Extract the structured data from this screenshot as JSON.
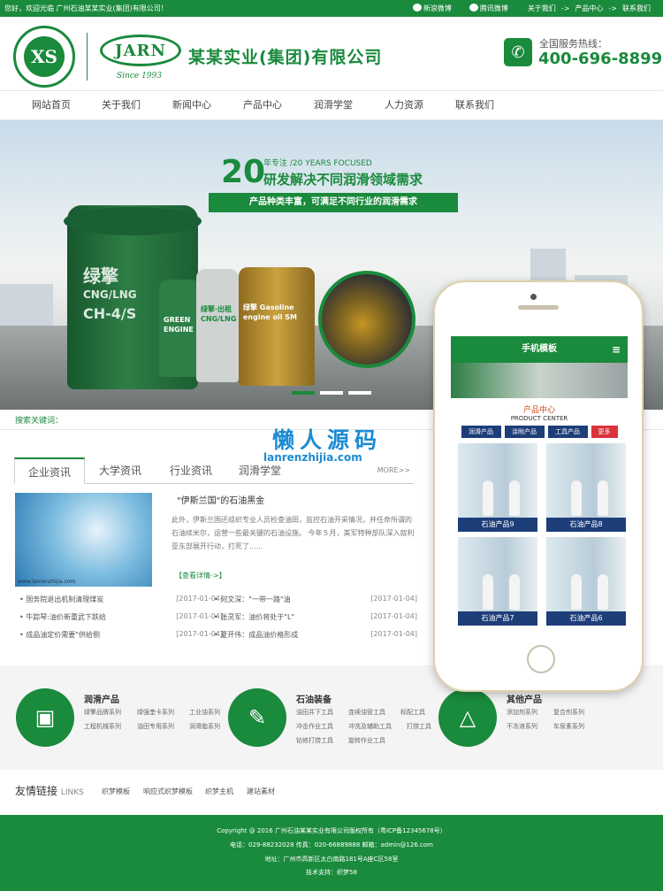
{
  "topbar": {
    "welcome": "您好，欢迎光临 广州石油某某实业(集团)有限公司！",
    "weibo_sina": "新浪微博",
    "weibo_tencent": "腾讯微博",
    "link_about": "关于我们",
    "link_products": "产品中心",
    "link_contact": "联系我们",
    "arrow": "->"
  },
  "header": {
    "emblem_text": "XS",
    "brand": "JARN",
    "since": "Since 1993",
    "company": "某某实业(集团)有限公司",
    "hotline_label": "全国服务热线：",
    "hotline": "400-696-8899"
  },
  "nav": [
    "网站首页",
    "关于我们",
    "新闻中心",
    "产品中心",
    "润滑学堂",
    "人力资源",
    "联系我们"
  ],
  "banner": {
    "years": "20",
    "years_unit": "年专注",
    "years_en": "/20 YEARS FOCUSED",
    "headline": "研发解决不同润滑领域需求",
    "ribbon": "产品种类丰富，可满足不同行业的润滑需求",
    "bucket_text": [
      "绿擎",
      "CNG/LNG",
      "CH-4/S"
    ],
    "jug1": "GREEN ENGINE",
    "jug2": "绿擎·出租 CNG/LNG",
    "jug3": "绿擎 Gasoline engine oil SM"
  },
  "search_label": "搜索关键词：",
  "news": {
    "tabs": [
      "企业资讯",
      "大学资讯",
      "行业资讯",
      "润滑学堂"
    ],
    "more": "MORE>>",
    "featured_title": "\"伊斯兰国\"的石油黑金",
    "featured_desc": "此外，伊斯兰国还组织专业人员检查油田，监控石油开采情况，并任命所谓的石油续米尔，运营一些最关键的石油设施。 今年５月，美军特种部队深入叙利亚东部展开行动，打死了......",
    "featured_more": "【查看详情->】",
    "image_caption": "www.lanrenzhijia.com",
    "left": [
      {
        "title": "国务院退出机制清理煤炭",
        "date": "[2017-01-04]"
      },
      {
        "title": "牛踪琴:油价新重武下跌给",
        "date": "[2017-01-04]"
      },
      {
        "title": "成品油定价需要\"供给侧",
        "date": "[2017-01-04]"
      }
    ],
    "right": [
      {
        "title": "何文深：\"一带一路\"油",
        "date": "[2017-01-04]"
      },
      {
        "title": "张灵军：油价将处于\"L\"",
        "date": "[2017-01-04]"
      },
      {
        "title": "夏开伟：成品油价格形成",
        "date": "[2017-01-04]"
      }
    ]
  },
  "mobile": {
    "header": "手机模板",
    "menu_icon": "≡",
    "section_title": "产品中心",
    "section_sub": "PRODUCT CENTER",
    "tabs": [
      "润滑产品",
      "涂附产品",
      "工具产品",
      "更多"
    ],
    "products": [
      "石油产品9",
      "石油产品8",
      "石油产品7",
      "石油产品6"
    ]
  },
  "watermark": {
    "cn": "懒人源码",
    "url": "lanrenzhijia.com"
  },
  "categories": [
    {
      "icon": "oil-can-icon",
      "glyph": "🛢",
      "title": "润滑产品",
      "items": [
        "绿擎品牌系列",
        "绿强奎卡系列",
        "工业油系列",
        "工程机械系列",
        "油田专用系列",
        "润滑脂系列"
      ]
    },
    {
      "icon": "wrench-icon",
      "glyph": "🔧",
      "title": "石油装备",
      "items": [
        "油田井下工具",
        "连续油管工具",
        "标配工具",
        "冲击作业工具",
        "冲洗及辅助工具",
        "打捞工具",
        "钻修打捞工具",
        "旋转作业工具"
      ]
    },
    {
      "icon": "flask-icon",
      "glyph": "⚗",
      "title": "其他产品",
      "items": [
        "添加剂系列",
        "复合剂系列",
        "不冻液系列",
        "车尿素系列"
      ]
    }
  ],
  "links": {
    "title": "友情链接",
    "title_en": "LINKS",
    "items": [
      "织梦模板",
      "响应式织梦模板",
      "织梦主机",
      "建站素材"
    ]
  },
  "footer": {
    "copyright": "Copyright @ 2016 广州石油某某实业有限公司版权所有（粤ICP备12345678号）",
    "contact": "电话：029-88232028    传真：020-66889888    邮箱：admin@126.com",
    "address": "地址：广州市高新区太白南路181号A座C区58室",
    "support": "技术支持：织梦58"
  },
  "colors": {
    "brand": "#1a8a3c",
    "mobile_tab": "#1e3e7a",
    "more_tab": "#d9343a",
    "watermark": "#1b8bd4"
  }
}
